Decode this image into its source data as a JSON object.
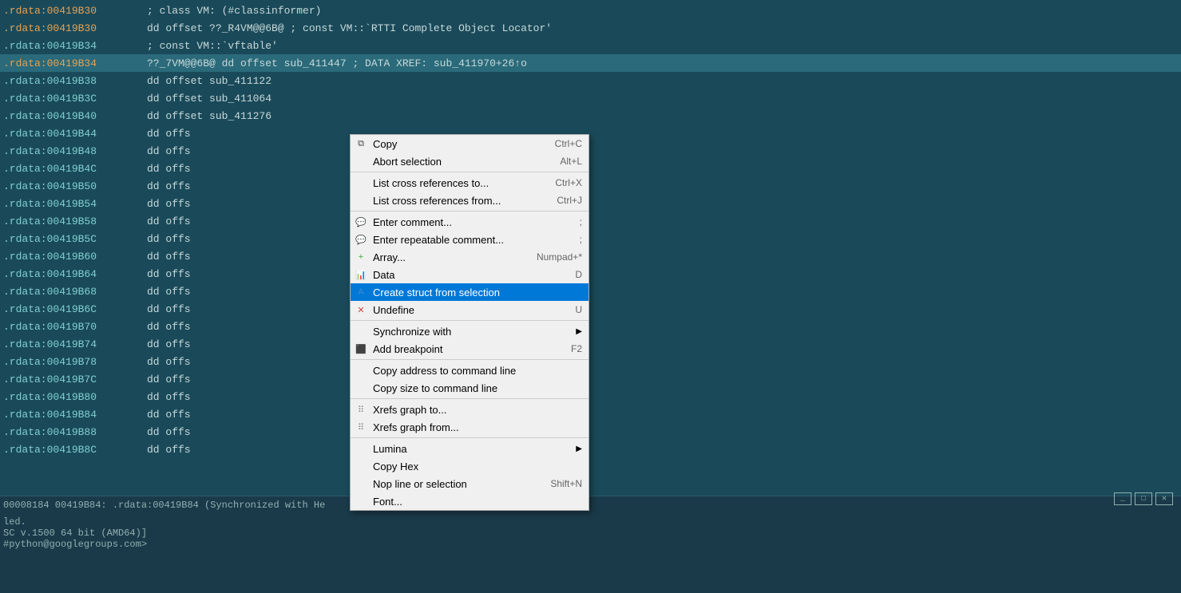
{
  "code_lines": [
    {
      "addr": ".rdata:00419B30",
      "addr_class": "orange",
      "content": " ; class VM:    (#classinformer)",
      "highlighted": false
    },
    {
      "addr": ".rdata:00419B30",
      "addr_class": "orange",
      "content": "          dd offset ??_R4VM@@6B@  ; const VM::`RTTI Complete Object Locator'",
      "highlighted": false
    },
    {
      "addr": ".rdata:00419B34",
      "addr_class": "normal",
      "content": " ; const VM::`vftable'",
      "highlighted": false
    },
    {
      "addr": ".rdata:00419B34",
      "addr_class": "orange",
      "content": " ??_7VM@@6B@          dd offset sub_411447       ; DATA XREF: sub_411970+26↑o",
      "highlighted": true
    },
    {
      "addr": ".rdata:00419B38",
      "addr_class": "normal",
      "content": "                       dd offset sub_411122",
      "highlighted": false
    },
    {
      "addr": ".rdata:00419B3C",
      "addr_class": "normal",
      "content": "                       dd offset sub_411064",
      "highlighted": false
    },
    {
      "addr": ".rdata:00419B40",
      "addr_class": "normal",
      "content": "                       dd offset sub_411276",
      "highlighted": false
    },
    {
      "addr": ".rdata:00419B44",
      "addr_class": "normal",
      "content": "                       dd offs",
      "highlighted": false
    },
    {
      "addr": ".rdata:00419B48",
      "addr_class": "normal",
      "content": "                       dd offs",
      "highlighted": false
    },
    {
      "addr": ".rdata:00419B4C",
      "addr_class": "normal",
      "content": "                       dd offs",
      "highlighted": false
    },
    {
      "addr": ".rdata:00419B50",
      "addr_class": "normal",
      "content": "                       dd offs",
      "highlighted": false
    },
    {
      "addr": ".rdata:00419B54",
      "addr_class": "normal",
      "content": "                       dd offs",
      "highlighted": false
    },
    {
      "addr": ".rdata:00419B58",
      "addr_class": "normal",
      "content": "                       dd offs",
      "highlighted": false
    },
    {
      "addr": ".rdata:00419B5C",
      "addr_class": "normal",
      "content": "                       dd offs",
      "highlighted": false
    },
    {
      "addr": ".rdata:00419B60",
      "addr_class": "normal",
      "content": "                       dd offs",
      "highlighted": false
    },
    {
      "addr": ".rdata:00419B64",
      "addr_class": "normal",
      "content": "                       dd offs",
      "highlighted": false
    },
    {
      "addr": ".rdata:00419B68",
      "addr_class": "normal",
      "content": "                       dd offs",
      "highlighted": false
    },
    {
      "addr": ".rdata:00419B6C",
      "addr_class": "normal",
      "content": "                       dd offs",
      "highlighted": false
    },
    {
      "addr": ".rdata:00419B70",
      "addr_class": "normal",
      "content": "                       dd offs",
      "highlighted": false
    },
    {
      "addr": ".rdata:00419B74",
      "addr_class": "normal",
      "content": "                       dd offs",
      "highlighted": false
    },
    {
      "addr": ".rdata:00419B78",
      "addr_class": "normal",
      "content": "                       dd offs",
      "highlighted": false
    },
    {
      "addr": ".rdata:00419B7C",
      "addr_class": "normal",
      "content": "                       dd offs",
      "highlighted": false
    },
    {
      "addr": ".rdata:00419B80",
      "addr_class": "normal",
      "content": "                       dd offs",
      "highlighted": false
    },
    {
      "addr": ".rdata:00419B84",
      "addr_class": "normal",
      "content": "                       dd offs",
      "highlighted": false
    },
    {
      "addr": ".rdata:00419B88",
      "addr_class": "normal",
      "content": "                       dd offs",
      "highlighted": false
    },
    {
      "addr": ".rdata:00419B8C",
      "addr_class": "normal",
      "content": "                       dd offs",
      "highlighted": false
    }
  ],
  "status_bar": {
    "text": "00008184  00419B84:  .rdata:00419B84  (Synchronized with He"
  },
  "bottom_text": {
    "line1": "led.",
    "line2": "SC v.1500 64 bit (AMD64)]",
    "line3": "#python@googlegroups.com>"
  },
  "context_menu": {
    "items": [
      {
        "id": "copy",
        "label": "Copy",
        "shortcut": "Ctrl+C",
        "icon": "copy",
        "separator_after": false
      },
      {
        "id": "abort-selection",
        "label": "Abort selection",
        "shortcut": "Alt+L",
        "icon": "",
        "separator_after": true
      },
      {
        "id": "list-xrefs-to",
        "label": "List cross references to...",
        "shortcut": "Ctrl+X",
        "icon": "",
        "separator_after": false
      },
      {
        "id": "list-xrefs-from",
        "label": "List cross references from...",
        "shortcut": "Ctrl+J",
        "icon": "",
        "separator_after": true
      },
      {
        "id": "enter-comment",
        "label": "Enter comment...",
        "shortcut": ";",
        "icon": "comment",
        "separator_after": false
      },
      {
        "id": "enter-repeatable-comment",
        "label": "Enter repeatable comment...",
        "shortcut": ";",
        "icon": "comment",
        "separator_after": false
      },
      {
        "id": "array",
        "label": "Array...",
        "shortcut": "Numpad+*",
        "icon": "array",
        "separator_after": false
      },
      {
        "id": "data",
        "label": "Data",
        "shortcut": "D",
        "icon": "data",
        "separator_after": false
      },
      {
        "id": "create-struct",
        "label": "Create struct from selection",
        "shortcut": "",
        "icon": "struct",
        "highlighted": true,
        "separator_after": false
      },
      {
        "id": "undefine",
        "label": "Undefine",
        "shortcut": "U",
        "icon": "undefine",
        "separator_after": true
      },
      {
        "id": "synchronize-with",
        "label": "Synchronize with",
        "shortcut": "",
        "icon": "",
        "has_submenu": true,
        "separator_after": false
      },
      {
        "id": "add-breakpoint",
        "label": "Add breakpoint",
        "shortcut": "F2",
        "icon": "breakpoint",
        "separator_after": true
      },
      {
        "id": "copy-addr-cmdline",
        "label": "Copy address to command line",
        "shortcut": "",
        "icon": "",
        "separator_after": false
      },
      {
        "id": "copy-size-cmdline",
        "label": "Copy size to command line",
        "shortcut": "",
        "icon": "",
        "separator_after": true
      },
      {
        "id": "xrefs-graph-to",
        "label": "Xrefs graph to...",
        "shortcut": "",
        "icon": "xrefs",
        "separator_after": false
      },
      {
        "id": "xrefs-graph-from",
        "label": "Xrefs graph from...",
        "shortcut": "",
        "icon": "xrefs",
        "separator_after": true
      },
      {
        "id": "lumina",
        "label": "Lumina",
        "shortcut": "",
        "icon": "",
        "has_submenu": true,
        "separator_after": false
      },
      {
        "id": "copy-hex",
        "label": "Copy Hex",
        "shortcut": "",
        "icon": "",
        "separator_after": false
      },
      {
        "id": "nop-line",
        "label": "Nop line or selection",
        "shortcut": "Shift+N",
        "icon": "",
        "separator_after": false
      },
      {
        "id": "font",
        "label": "Font...",
        "shortcut": "",
        "icon": "",
        "separator_after": false
      }
    ]
  }
}
